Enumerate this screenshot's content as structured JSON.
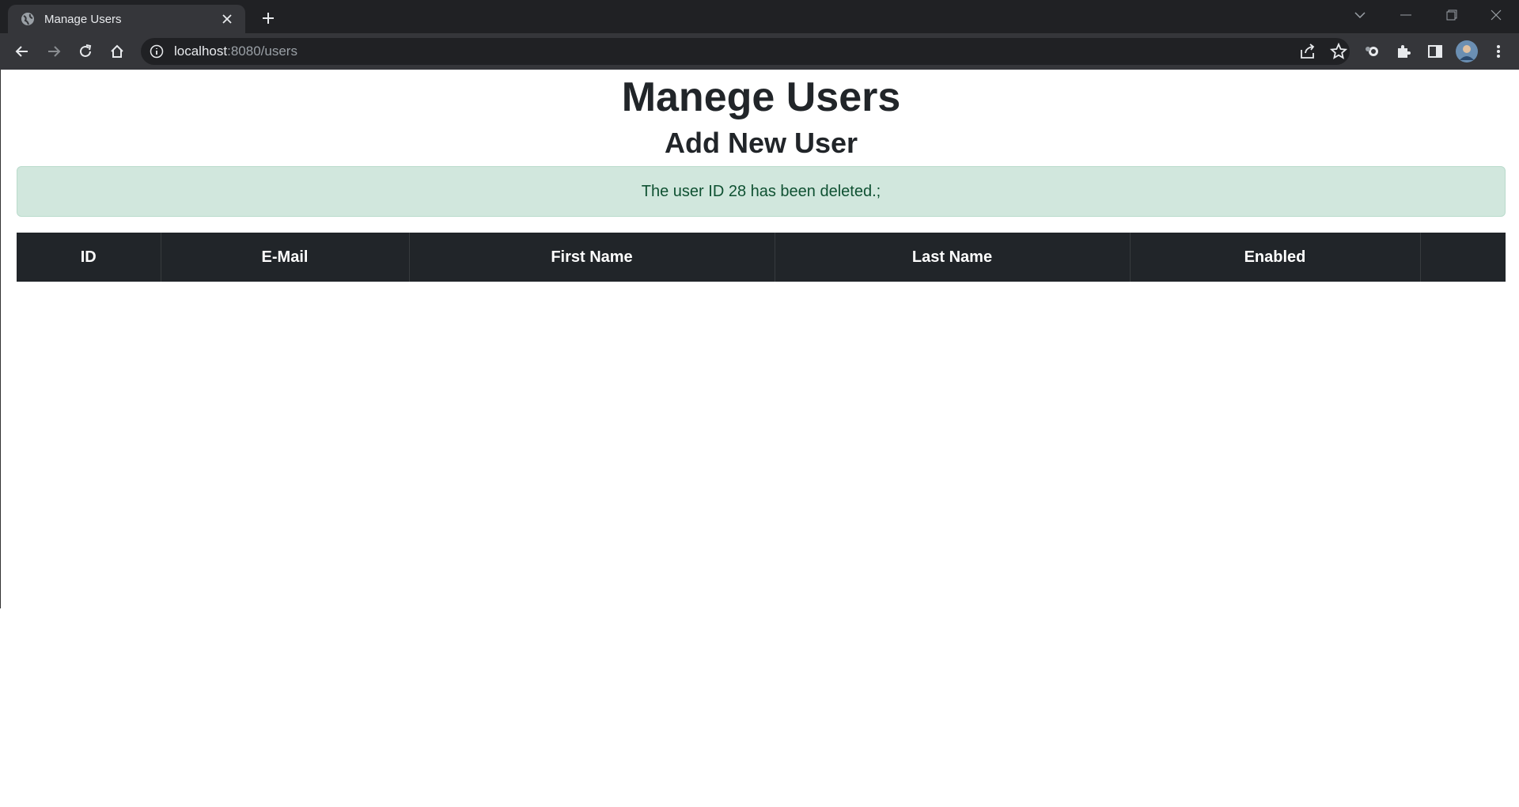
{
  "browser": {
    "tab_title": "Manage Users",
    "url_host": "localhost",
    "url_rest": ":8080/users",
    "icons": [
      "globe-icon",
      "close-icon",
      "plus-icon",
      "chevron-down-icon",
      "minimize-icon",
      "restore-icon",
      "window-close-icon",
      "back-icon",
      "forward-icon",
      "reload-icon",
      "home-icon",
      "info-icon",
      "share-icon",
      "star-icon",
      "extension-icon",
      "puzzle-icon",
      "sidepanel-icon",
      "avatar",
      "more-icon"
    ]
  },
  "page": {
    "title": "Manege Users",
    "add_user_link": "Add New User",
    "alert_message": "The user ID 28 has been deleted.;",
    "alert_color": "#d1e7dd",
    "table": {
      "columns": [
        "ID",
        "E-Mail",
        "First Name",
        "Last Name",
        "Enabled",
        ""
      ],
      "rows": []
    }
  }
}
